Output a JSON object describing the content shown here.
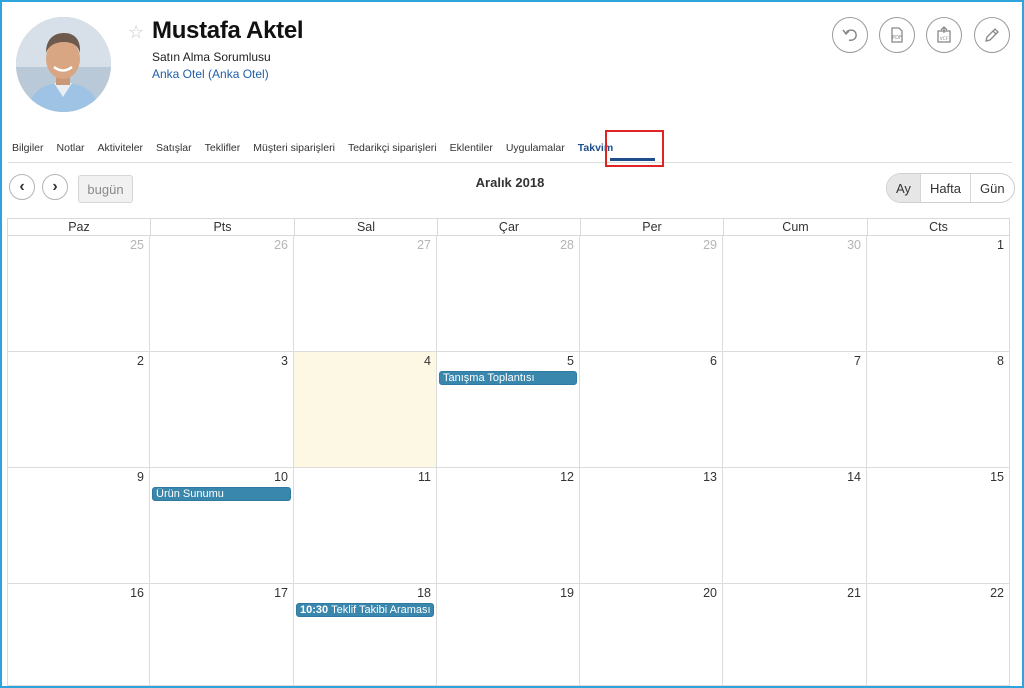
{
  "contact": {
    "name": "Mustafa Aktel",
    "role": "Satın Alma Sorumlusu",
    "company": "Anka Otel (Anka Otel)",
    "star_icon": "star-outline-icon"
  },
  "actions": [
    {
      "name": "undo-icon"
    },
    {
      "name": "pdf-icon"
    },
    {
      "name": "vcf-export-icon"
    },
    {
      "name": "edit-pencil-icon"
    }
  ],
  "tabs": [
    {
      "label": "Bilgiler"
    },
    {
      "label": "Notlar"
    },
    {
      "label": "Aktiviteler"
    },
    {
      "label": "Satışlar"
    },
    {
      "label": "Teklifler"
    },
    {
      "label": "Müşteri siparişleri"
    },
    {
      "label": "Tedarikçi siparişleri"
    },
    {
      "label": "Eklentiler"
    },
    {
      "label": "Uygulamalar"
    },
    {
      "label": "Takvim",
      "active": true
    }
  ],
  "toolbar": {
    "prev_icon": "chevron-left-icon",
    "next_icon": "chevron-right-icon",
    "today_label": "bugün",
    "title": "Aralık 2018",
    "views": [
      {
        "label": "Ay",
        "active": true
      },
      {
        "label": "Hafta"
      },
      {
        "label": "Gün"
      }
    ]
  },
  "calendar": {
    "weekdays": [
      "Paz",
      "Pts",
      "Sal",
      "Çar",
      "Per",
      "Cum",
      "Cts"
    ],
    "weeks": [
      [
        {
          "d": "25",
          "other": true
        },
        {
          "d": "26",
          "other": true
        },
        {
          "d": "27",
          "other": true
        },
        {
          "d": "28",
          "other": true
        },
        {
          "d": "29",
          "other": true
        },
        {
          "d": "30",
          "other": true
        },
        {
          "d": "1"
        }
      ],
      [
        {
          "d": "2"
        },
        {
          "d": "3"
        },
        {
          "d": "4",
          "today": true
        },
        {
          "d": "5",
          "events": [
            {
              "title": "Tanışma Toplantısı"
            }
          ]
        },
        {
          "d": "6"
        },
        {
          "d": "7"
        },
        {
          "d": "8"
        }
      ],
      [
        {
          "d": "9"
        },
        {
          "d": "10",
          "events": [
            {
              "title": "Ürün Sunumu"
            }
          ]
        },
        {
          "d": "11"
        },
        {
          "d": "12"
        },
        {
          "d": "13"
        },
        {
          "d": "14"
        },
        {
          "d": "15"
        }
      ],
      [
        {
          "d": "16"
        },
        {
          "d": "17"
        },
        {
          "d": "18",
          "events": [
            {
              "time": "10:30",
              "title": "Teklif Takibi Araması"
            }
          ]
        },
        {
          "d": "19"
        },
        {
          "d": "20"
        },
        {
          "d": "21"
        },
        {
          "d": "22"
        }
      ]
    ]
  },
  "colors": {
    "accent": "#1f4f8a",
    "event": "#3a87ad",
    "today": "#fcf8e3",
    "highlight": "#e02424",
    "frame": "#2ea3dc"
  }
}
